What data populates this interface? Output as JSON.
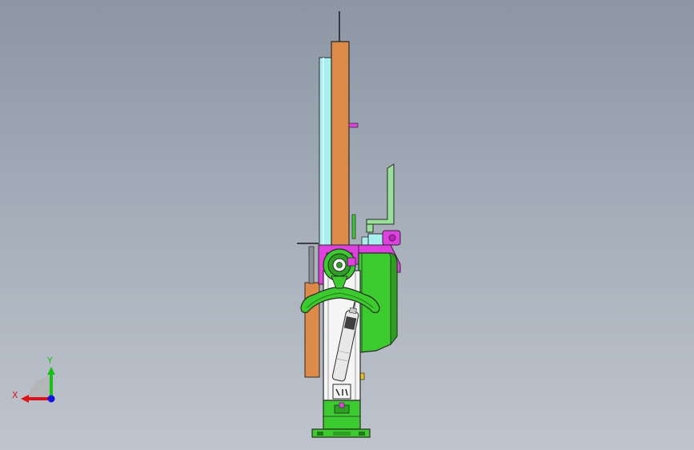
{
  "triad": {
    "x_label": "X",
    "y_label": "Y",
    "x_color": "#e0101a",
    "y_color": "#18c018",
    "z_color": "#1010e0"
  },
  "colors": {
    "background_top": "#8c96a4",
    "background_bottom": "#bfc5cd",
    "orange_post": "#de8a48",
    "cyan_rod": "#a8f0f0",
    "green_base": "#3ccb2e",
    "magenta_bracket": "#e040e0",
    "light_green_handle": "#9ae098",
    "white_housing": "#f5f5f5",
    "edge_line": "#1a1a1a"
  }
}
